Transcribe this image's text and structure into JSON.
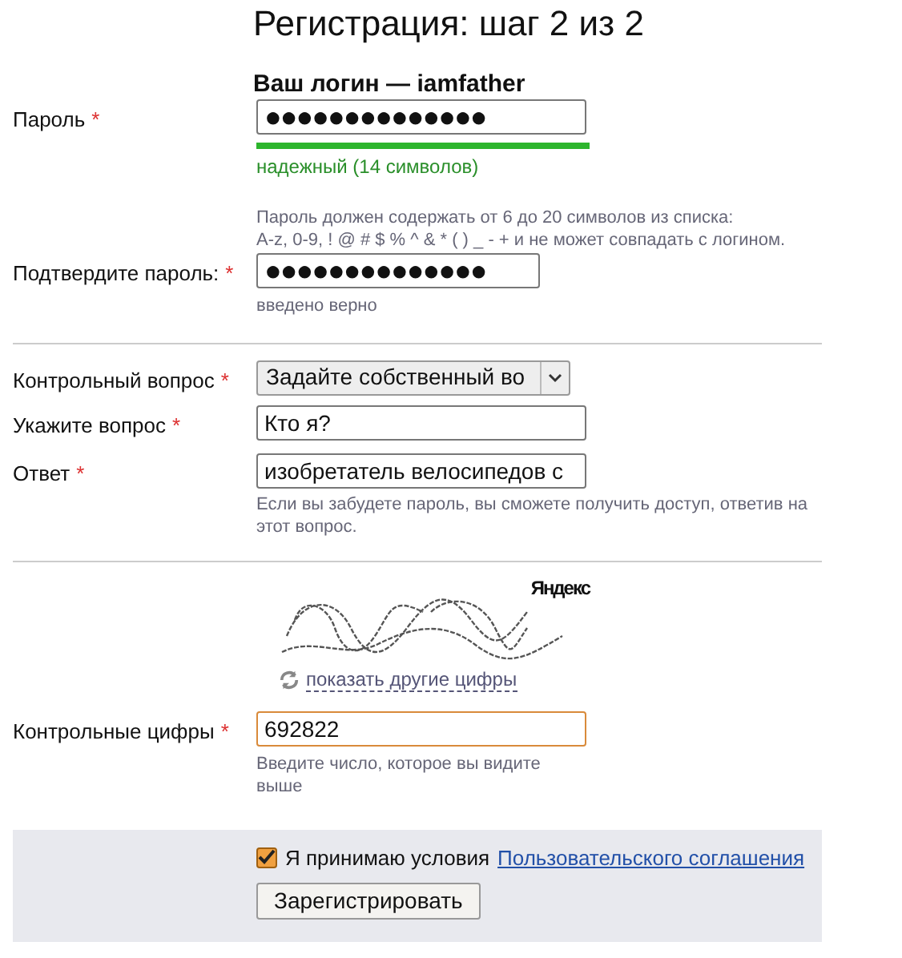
{
  "title": "Регистрация: шаг 2 из 2",
  "login_heading": "Ваш логин — iamfather",
  "password": {
    "label": "Пароль",
    "required_mark": "*",
    "value": "●●●●●●●●●●●●●●",
    "strength": {
      "level": 1,
      "text": "надежный (14 символов)"
    },
    "hint_lines": [
      "Пароль должен содержать от 6 до 20 символов из списка:",
      "A-z, 0-9, ! @ # $ % ^ & * ( ) _ - + и не может совпадать с логином."
    ]
  },
  "confirm": {
    "label": "Подтвердите пароль:",
    "required_mark": "*",
    "value": "●●●●●●●●●●●●●●",
    "status": "введено верно"
  },
  "question": {
    "label": "Контрольный вопрос",
    "required_mark": "*",
    "value": "Задайте собственный во"
  },
  "custom_question": {
    "label": "Укажите вопрос",
    "required_mark": "*",
    "value": "Кто я?"
  },
  "answer": {
    "label": "Ответ",
    "required_mark": "*",
    "value": "изобретатель велосипедов с",
    "hint": "Если вы забудете пароль, вы сможете получить доступ, ответив на этот вопрос."
  },
  "captcha": {
    "logo": "Яндекс",
    "refresh_link": "показать другие цифры",
    "label": "Контрольные цифры",
    "required_mark": "*",
    "value": "692822",
    "focused": true,
    "hint": "Введите число, которое вы видите выше"
  },
  "terms": {
    "checked": true,
    "text": "Я принимаю условия",
    "link": "Пользовательского соглашения"
  },
  "submit": "Зарегистрировать"
}
